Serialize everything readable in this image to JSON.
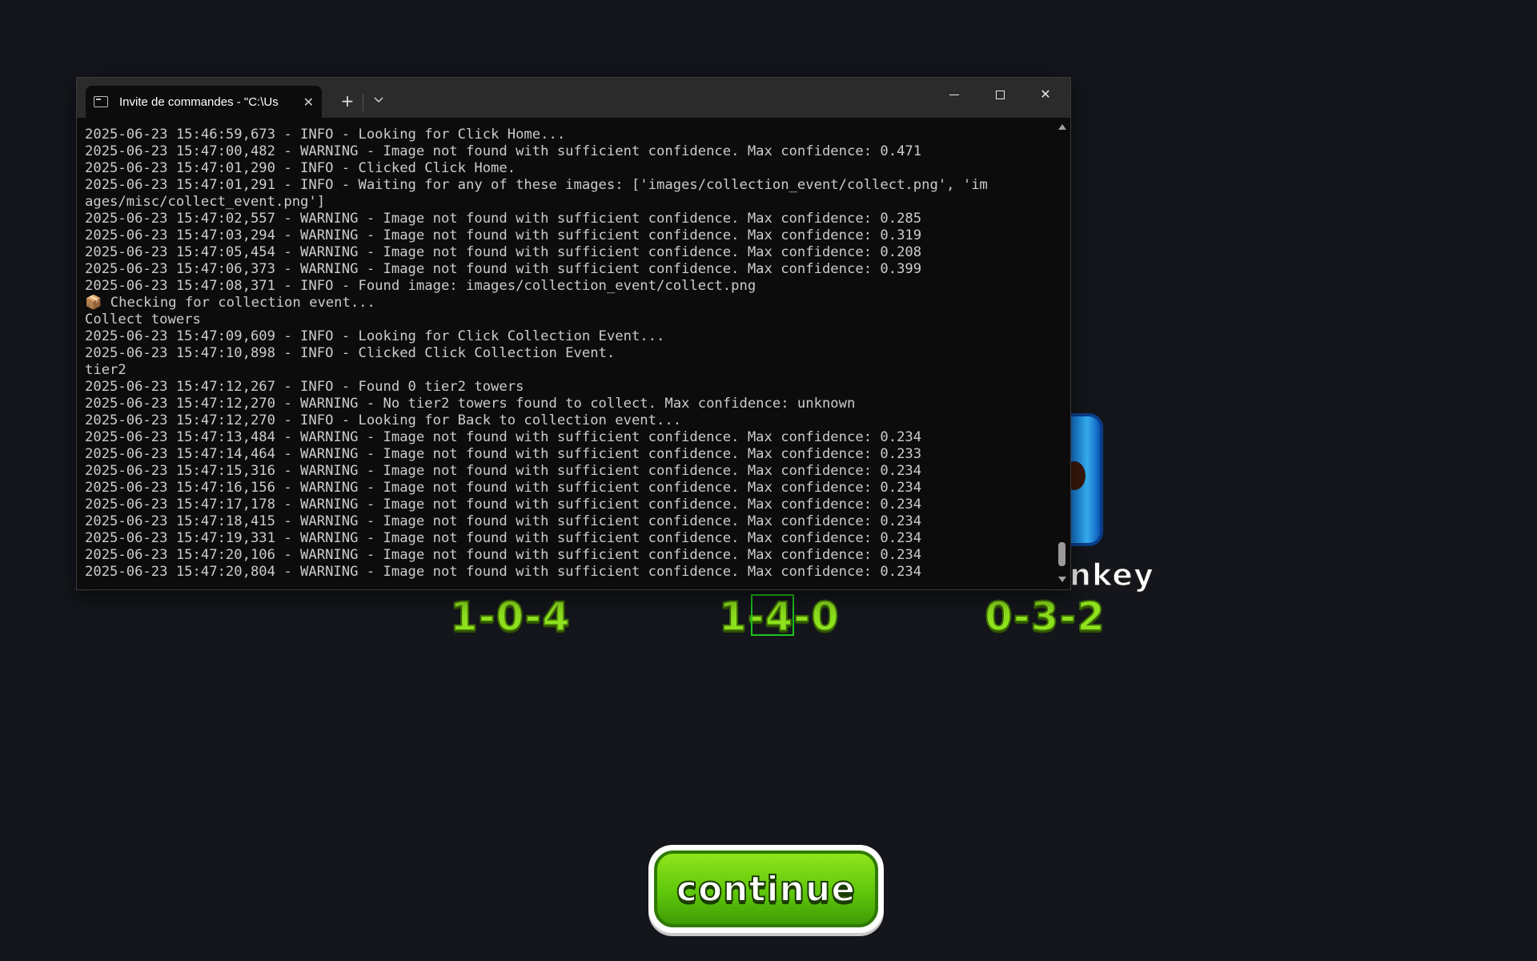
{
  "game": {
    "upgrade_paths": [
      "1-0-4",
      "1-4-0",
      "0-3-2"
    ],
    "monkey_label_fragment": "nkey",
    "continue_label": "continue",
    "colors": {
      "upgrade_text": "#8ee21e",
      "highlight_box": "#1ec41e",
      "continue_button": "#5fc70b"
    }
  },
  "terminal": {
    "tab_title": "Invite de commandes - \"C:\\Us",
    "tab_icon": "console-icon",
    "buttons": {
      "new_tab": "+",
      "dropdown": "⌵",
      "close_tab": "✕",
      "close_window": "✕"
    },
    "lines": [
      "2025-06-23 15:46:59,673 - INFO - Looking for Click Home...",
      "2025-06-23 15:47:00,482 - WARNING - Image not found with sufficient confidence. Max confidence: 0.471",
      "2025-06-23 15:47:01,290 - INFO - Clicked Click Home.",
      "2025-06-23 15:47:01,291 - INFO - Waiting for any of these images: ['images/collection_event/collect.png', 'im",
      "ages/misc/collect_event.png']",
      "2025-06-23 15:47:02,557 - WARNING - Image not found with sufficient confidence. Max confidence: 0.285",
      "2025-06-23 15:47:03,294 - WARNING - Image not found with sufficient confidence. Max confidence: 0.319",
      "2025-06-23 15:47:05,454 - WARNING - Image not found with sufficient confidence. Max confidence: 0.208",
      "2025-06-23 15:47:06,373 - WARNING - Image not found with sufficient confidence. Max confidence: 0.399",
      "2025-06-23 15:47:08,371 - INFO - Found image: images/collection_event/collect.png",
      "📦 Checking for collection event...",
      "Collect towers",
      "2025-06-23 15:47:09,609 - INFO - Looking for Click Collection Event...",
      "2025-06-23 15:47:10,898 - INFO - Clicked Click Collection Event.",
      "tier2",
      "2025-06-23 15:47:12,267 - INFO - Found 0 tier2 towers",
      "2025-06-23 15:47:12,270 - WARNING - No tier2 towers found to collect. Max confidence: unknown",
      "2025-06-23 15:47:12,270 - INFO - Looking for Back to collection event...",
      "2025-06-23 15:47:13,484 - WARNING - Image not found with sufficient confidence. Max confidence: 0.234",
      "2025-06-23 15:47:14,464 - WARNING - Image not found with sufficient confidence. Max confidence: 0.233",
      "2025-06-23 15:47:15,316 - WARNING - Image not found with sufficient confidence. Max confidence: 0.234",
      "2025-06-23 15:47:16,156 - WARNING - Image not found with sufficient confidence. Max confidence: 0.234",
      "2025-06-23 15:47:17,178 - WARNING - Image not found with sufficient confidence. Max confidence: 0.234",
      "2025-06-23 15:47:18,415 - WARNING - Image not found with sufficient confidence. Max confidence: 0.234",
      "2025-06-23 15:47:19,331 - WARNING - Image not found with sufficient confidence. Max confidence: 0.234",
      "2025-06-23 15:47:20,106 - WARNING - Image not found with sufficient confidence. Max confidence: 0.234",
      "2025-06-23 15:47:20,804 - WARNING - Image not found with sufficient confidence. Max confidence: 0.234"
    ]
  }
}
